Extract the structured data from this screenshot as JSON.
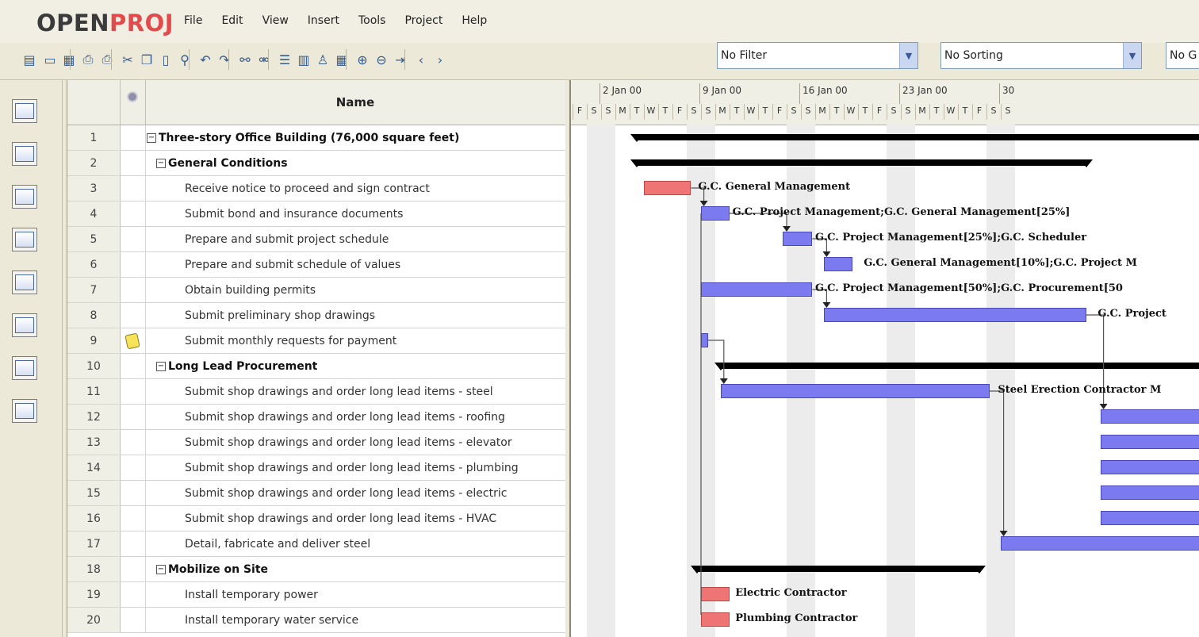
{
  "app": {
    "logo_open": "OPEN",
    "logo_proj": "PROJ"
  },
  "menu": [
    "File",
    "Edit",
    "View",
    "Insert",
    "Tools",
    "Project",
    "Help"
  ],
  "toolbar": {
    "filter_value": "No Filter",
    "sorting_value": "No Sorting",
    "group_value": "No G",
    "icons": [
      "new-project-icon",
      "open-icon",
      "save-icon",
      "print-preview-icon",
      "print-icon",
      "cut-icon",
      "copy-icon",
      "paste-icon",
      "find-icon",
      "undo-icon",
      "redo-icon",
      "link-icon",
      "unlink-icon",
      "task-info-icon",
      "notes-icon",
      "resource-icon",
      "calendar-icon",
      "zoom-in-icon",
      "zoom-out-icon",
      "scroll-to-task-icon",
      "back-icon",
      "forward-icon"
    ]
  },
  "views": [
    "gantt-view-icon",
    "network-view-icon",
    "resources-view-icon",
    "wbs-view-icon",
    "rbs-view-icon",
    "projects-view-icon",
    "report-view-icon",
    "resource-usage-view-icon"
  ],
  "grid": {
    "column_name": "Name",
    "rows": [
      {
        "id": "1",
        "name": "Three-story Office Building (76,000 square feet)",
        "level": 0,
        "summary": true,
        "note": false
      },
      {
        "id": "2",
        "name": "General Conditions",
        "level": 1,
        "summary": true,
        "note": false
      },
      {
        "id": "3",
        "name": "Receive notice to proceed and sign contract",
        "level": 2,
        "summary": false,
        "note": false
      },
      {
        "id": "4",
        "name": "Submit bond and insurance documents",
        "level": 2,
        "summary": false,
        "note": false
      },
      {
        "id": "5",
        "name": "Prepare and submit project schedule",
        "level": 2,
        "summary": false,
        "note": false
      },
      {
        "id": "6",
        "name": "Prepare and submit schedule of values",
        "level": 2,
        "summary": false,
        "note": false
      },
      {
        "id": "7",
        "name": "Obtain building permits",
        "level": 2,
        "summary": false,
        "note": false
      },
      {
        "id": "8",
        "name": "Submit preliminary shop drawings",
        "level": 2,
        "summary": false,
        "note": false
      },
      {
        "id": "9",
        "name": "Submit monthly requests for payment",
        "level": 2,
        "summary": false,
        "note": true
      },
      {
        "id": "10",
        "name": "Long Lead Procurement",
        "level": 1,
        "summary": true,
        "note": false
      },
      {
        "id": "11",
        "name": "Submit shop drawings and order long lead items - steel",
        "level": 2,
        "summary": false,
        "note": false
      },
      {
        "id": "12",
        "name": "Submit shop drawings and order long lead items - roofing",
        "level": 2,
        "summary": false,
        "note": false
      },
      {
        "id": "13",
        "name": "Submit shop drawings and order long lead items - elevator",
        "level": 2,
        "summary": false,
        "note": false
      },
      {
        "id": "14",
        "name": "Submit shop drawings and order long lead items - plumbing",
        "level": 2,
        "summary": false,
        "note": false
      },
      {
        "id": "15",
        "name": "Submit shop drawings and order long lead items - electric",
        "level": 2,
        "summary": false,
        "note": false
      },
      {
        "id": "16",
        "name": "Submit shop drawings and order long lead items - HVAC",
        "level": 2,
        "summary": false,
        "note": false
      },
      {
        "id": "17",
        "name": "Detail, fabricate and deliver steel",
        "level": 2,
        "summary": false,
        "note": false
      },
      {
        "id": "18",
        "name": "Mobilize on Site",
        "level": 1,
        "summary": true,
        "note": false
      },
      {
        "id": "19",
        "name": "Install temporary power",
        "level": 2,
        "summary": false,
        "note": false
      },
      {
        "id": "20",
        "name": "Install temporary water service",
        "level": 2,
        "summary": false,
        "note": false
      }
    ]
  },
  "gantt": {
    "weeks": [
      "2 Jan 00",
      "9 Jan 00",
      "16 Jan 00",
      "23 Jan 00",
      "30"
    ],
    "day_letters": [
      "F",
      "S",
      "S",
      "M",
      "T",
      "W",
      "T",
      "F",
      "S",
      "S",
      "M",
      "T",
      "W",
      "T",
      "F",
      "S",
      "S",
      "M",
      "T",
      "W",
      "T",
      "F",
      "S",
      "S",
      "M",
      "T",
      "W",
      "T",
      "F",
      "S",
      "S"
    ],
    "resource_labels": [
      {
        "row": 3,
        "text": "G.C. General Management"
      },
      {
        "row": 4,
        "text": "G.C. Project Management;G.C. General Management[25%]"
      },
      {
        "row": 5,
        "text": "G.C. Project Management[25%];G.C. Scheduler"
      },
      {
        "row": 6,
        "text": "G.C. General Management[10%];G.C. Project M"
      },
      {
        "row": 7,
        "text": "G.C. Project Management[50%];G.C. Procurement[50"
      },
      {
        "row": 8,
        "text": "G.C. Project"
      },
      {
        "row": 11,
        "text": "Steel Erection Contractor M"
      },
      {
        "row": 19,
        "text": "Electric Contractor"
      },
      {
        "row": 20,
        "text": "Plumbing Contractor"
      }
    ],
    "colors": {
      "task": "#7b7bef",
      "critical": "#ef7474",
      "summary": "#000000"
    }
  }
}
